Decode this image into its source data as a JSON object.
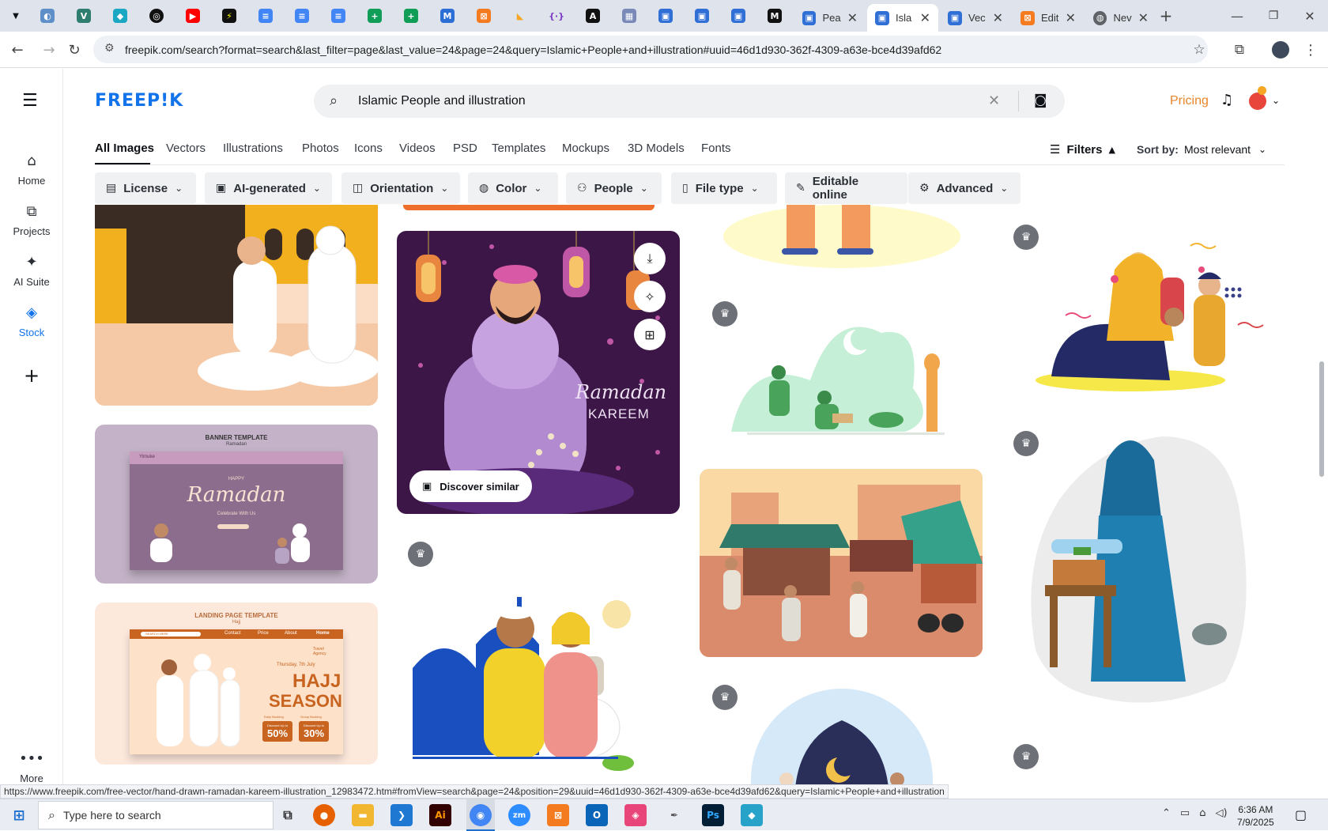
{
  "browser": {
    "tabs_icons": [
      "nav-dropdown",
      "edge-ext",
      "vpn",
      "chatgpt",
      "perplexity",
      "youtube",
      "topaz",
      "docs",
      "docs",
      "docs",
      "sheets",
      "sheets",
      "ms",
      "xampp",
      "tooljet",
      "regex",
      "aws",
      "tool",
      "slides",
      "slides",
      "slides",
      "medium"
    ],
    "tabs": [
      {
        "label": "Pea",
        "active": false
      },
      {
        "label": "Isla",
        "active": true
      },
      {
        "label": "Vec",
        "active": false
      },
      {
        "label": "Edit",
        "active": false
      },
      {
        "label": "Nev",
        "active": false
      }
    ],
    "url": "freepik.com/search?format=search&last_filter=page&last_value=24&page=24&query=Islamic+People+and+illustration#uuid=46d1d930-362f-4309-a63e-bce4d39afd62"
  },
  "sidebar": {
    "items": [
      {
        "label": "Home",
        "icon": "home-icon"
      },
      {
        "label": "Projects",
        "icon": "projects-icon"
      },
      {
        "label": "AI Suite",
        "icon": "sparkle-icon"
      },
      {
        "label": "Stock",
        "icon": "stock-icon"
      }
    ],
    "more_label": "More"
  },
  "header": {
    "logo": "FREEP!K",
    "search_value": "Islamic People and illustration",
    "pricing": "Pricing"
  },
  "type_tabs": [
    "All Images",
    "Vectors",
    "Illustrations",
    "Photos",
    "Icons",
    "Videos",
    "PSD",
    "Templates",
    "Mockups",
    "3D Models",
    "Fonts"
  ],
  "filters_label": "Filters",
  "sort": {
    "label": "Sort by:",
    "value": "Most relevant"
  },
  "chips": [
    "License",
    "AI-generated",
    "Orientation",
    "Color",
    "People",
    "File type",
    "Editable online",
    "Advanced"
  ],
  "cards": {
    "ramadan_hover": {
      "title_line1": "Ramadan",
      "title_line2": "KAREEM",
      "discover_label": "Discover similar"
    },
    "banner": {
      "header": "BANNER TEMPLATE",
      "subheader": "Ramadan",
      "site_name": "Yimuke",
      "happy": "HAPPY",
      "title": "Ramadan",
      "subtitle": "Celebrate With Us"
    },
    "landing": {
      "header": "LANDING PAGE TEMPLATE",
      "subheader": "Hajj",
      "search_hint": "SEARCH HERE",
      "nav": [
        "Contact",
        "Price",
        "About",
        "Home"
      ],
      "agency": "Travel Agency",
      "date": "Thursday, 7th July",
      "title1": "HAJJ",
      "title2": "SEASON",
      "label_early": "Early Booking",
      "label_group": "Group Booking",
      "discount_label": "Discount Up to",
      "discount1": "50%",
      "discount2": "30%"
    }
  },
  "status_url": "https://www.freepik.com/free-vector/hand-drawn-ramadan-kareem-illustration_12983472.htm#fromView=search&page=24&position=29&uuid=46d1d930-362f-4309-a63e-bce4d39afd62&query=Islamic+People+and+illustration",
  "taskbar": {
    "search_placeholder": "Type here to search",
    "time": "6:36 AM",
    "date": "7/9/2025"
  }
}
